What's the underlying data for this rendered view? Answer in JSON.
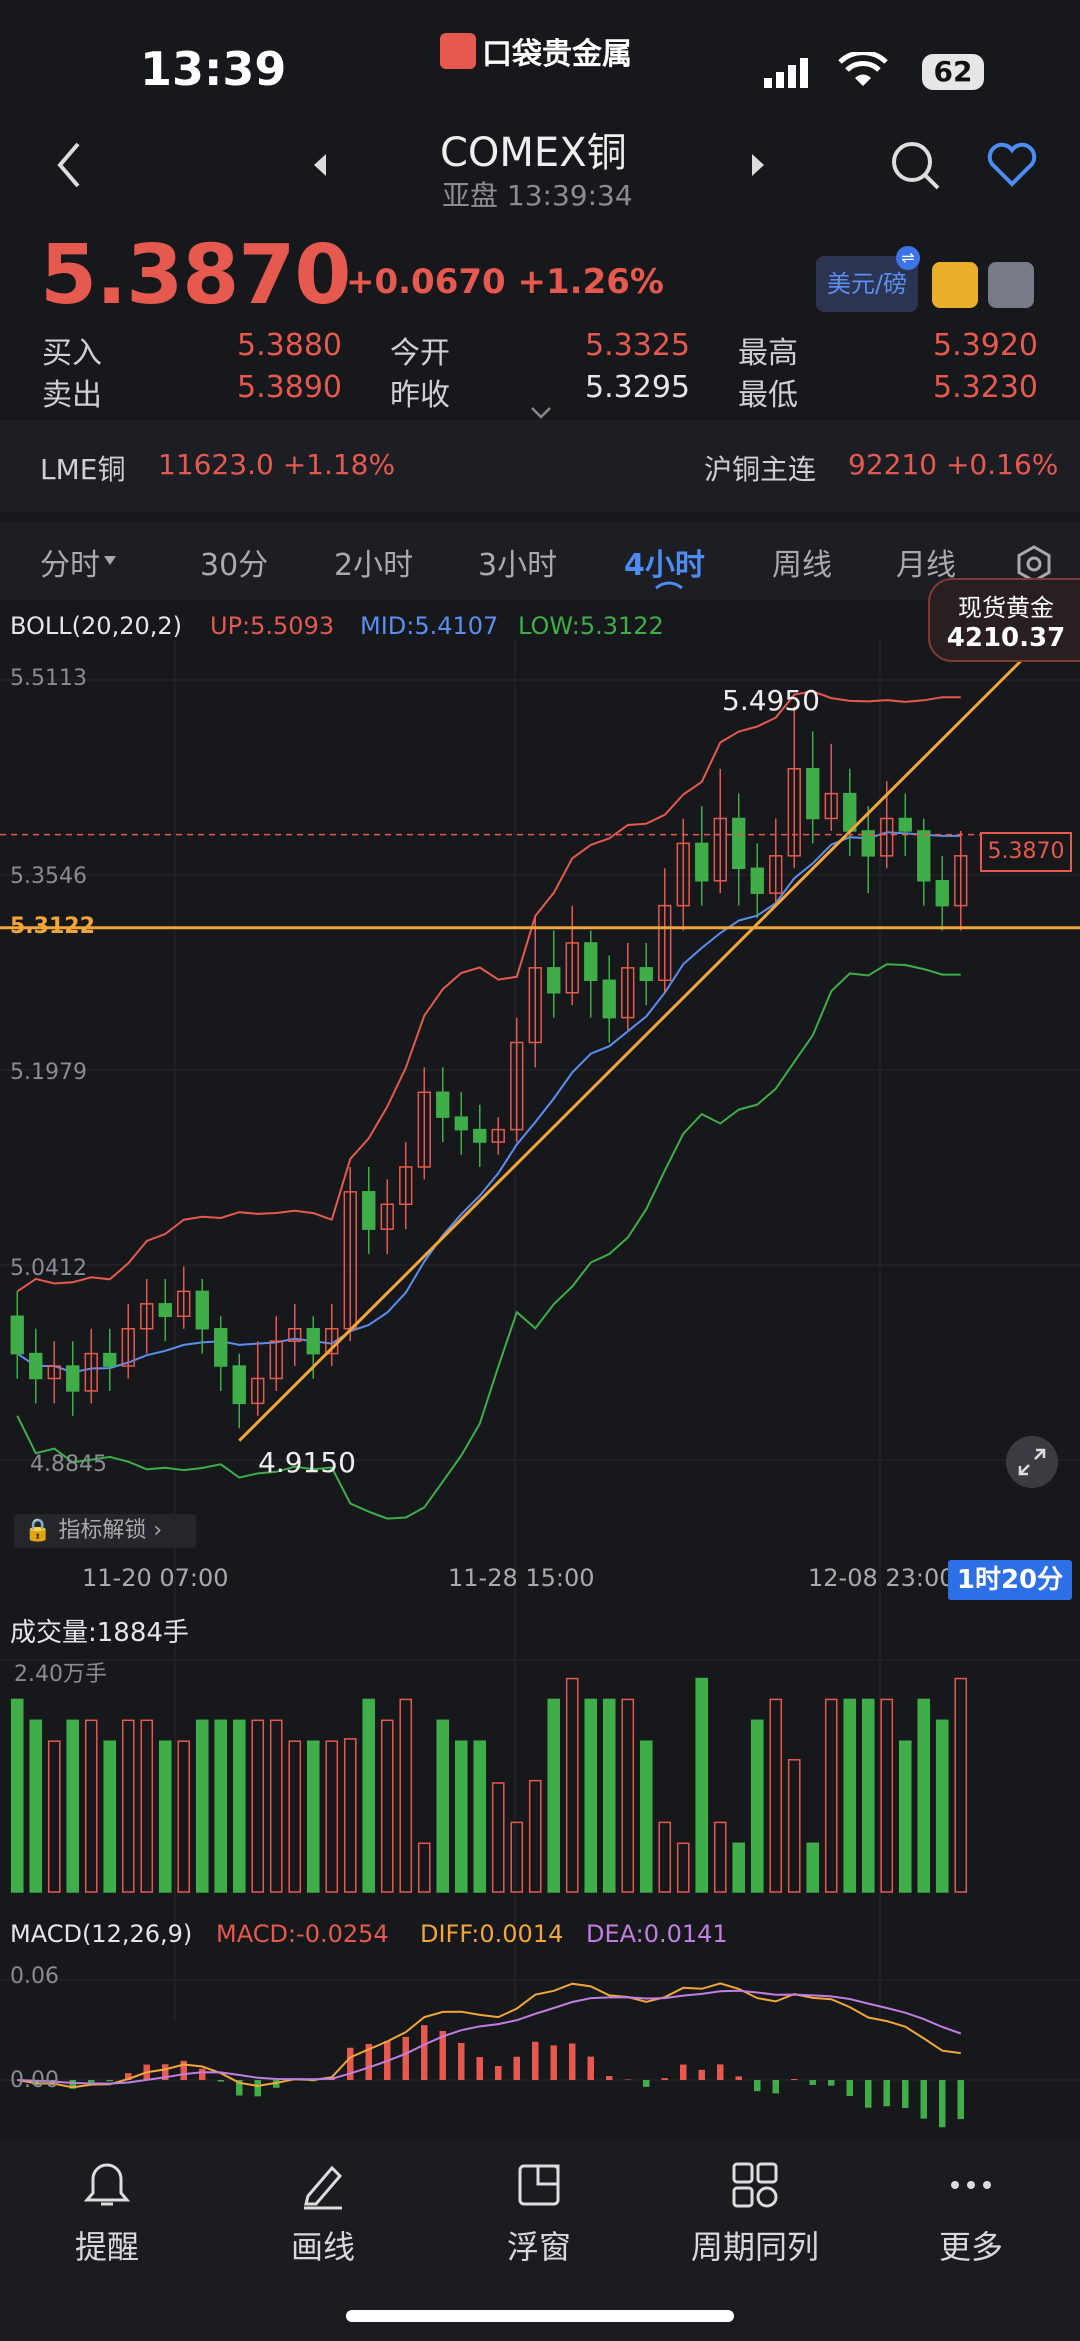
{
  "status_bar": {
    "time": "13:39",
    "battery": "62",
    "logo_text": "口袋贵金属"
  },
  "header": {
    "title": "COMEX铜",
    "subtitle": "亚盘 13:39:34"
  },
  "price": {
    "current": "5.3870",
    "change": "+0.0670 +1.26%",
    "currency_button": "美元/磅",
    "currency_badge": "⇌"
  },
  "quote": {
    "buy_label": "买入",
    "buy_value": "5.3880",
    "sell_label": "卖出",
    "sell_value": "5.3890",
    "open_label": "今开",
    "open_value": "5.3325",
    "prev_close_label": "昨收",
    "prev_close_value": "5.3295",
    "high_label": "最高",
    "high_value": "5.3920",
    "low_label": "最低",
    "low_value": "5.3230"
  },
  "related": {
    "lme_label": "LME铜",
    "lme_value": "11623.0 +1.18%",
    "sh_label": "沪铜主连",
    "sh_value": "92210 +0.16%"
  },
  "tabs": [
    "分时",
    "30分",
    "2小时",
    "3小时",
    "4小时",
    "周线",
    "月线"
  ],
  "active_tab": "4小时",
  "chart_data": {
    "type": "candlestick",
    "indicator": "BOLL(20,20,2)",
    "up_label": "UP:5.5093",
    "mid_label": "MID:5.4107",
    "low_label": "LOW:5.3122",
    "y_ticks": [
      "5.5113",
      "5.3546",
      "5.1979",
      "5.0412",
      "4.8845"
    ],
    "support_level": "5.3122",
    "high_marker": "5.4950",
    "low_marker": "4.9150",
    "current_price_tag": "5.3870",
    "x_ticks": [
      "11-20 07:00",
      "11-28 15:00",
      "12-08 23:00"
    ],
    "countdown": "1时20分",
    "spot_gold_label": "现货黄金",
    "spot_gold_value": "4210.37",
    "unlock_label": "指标解锁",
    "volume_title": "成交量:1884手",
    "volume_max": "2.40万手",
    "macd_title": "MACD(12,26,9)",
    "macd_value": "MACD:-0.0254",
    "diff_value": "DIFF:0.0014",
    "dea_value": "DEA:0.0141",
    "macd_ticks": [
      "0.06",
      "0.00"
    ],
    "candles": [
      [
        5.0,
        4.97,
        5.02,
        4.95
      ],
      [
        4.97,
        4.95,
        4.99,
        4.93
      ],
      [
        4.95,
        4.96,
        4.98,
        4.93
      ],
      [
        4.96,
        4.94,
        4.98,
        4.92
      ],
      [
        4.94,
        4.97,
        4.99,
        4.93
      ],
      [
        4.97,
        4.96,
        4.99,
        4.94
      ],
      [
        4.96,
        4.99,
        5.01,
        4.95
      ],
      [
        4.99,
        5.01,
        5.03,
        4.97
      ],
      [
        5.01,
        5.0,
        5.03,
        4.98
      ],
      [
        5.0,
        5.02,
        5.04,
        4.99
      ],
      [
        5.02,
        4.99,
        5.03,
        4.97
      ],
      [
        4.99,
        4.96,
        5.0,
        4.94
      ],
      [
        4.96,
        4.93,
        4.97,
        4.91
      ],
      [
        4.93,
        4.95,
        4.98,
        4.92
      ],
      [
        4.95,
        4.98,
        5.0,
        4.94
      ],
      [
        4.98,
        4.99,
        5.01,
        4.96
      ],
      [
        4.99,
        4.97,
        5.0,
        4.95
      ],
      [
        4.97,
        4.99,
        5.01,
        4.96
      ],
      [
        4.99,
        5.1,
        5.12,
        4.98
      ],
      [
        5.1,
        5.07,
        5.12,
        5.05
      ],
      [
        5.07,
        5.09,
        5.11,
        5.05
      ],
      [
        5.09,
        5.12,
        5.14,
        5.07
      ],
      [
        5.12,
        5.18,
        5.2,
        5.11
      ],
      [
        5.18,
        5.16,
        5.2,
        5.14
      ],
      [
        5.16,
        5.15,
        5.18,
        5.13
      ],
      [
        5.15,
        5.14,
        5.17,
        5.12
      ],
      [
        5.14,
        5.15,
        5.16,
        5.13
      ],
      [
        5.15,
        5.22,
        5.24,
        5.14
      ],
      [
        5.22,
        5.28,
        5.32,
        5.2
      ],
      [
        5.28,
        5.26,
        5.31,
        5.24
      ],
      [
        5.26,
        5.3,
        5.33,
        5.25
      ],
      [
        5.3,
        5.27,
        5.31,
        5.24
      ],
      [
        5.27,
        5.24,
        5.29,
        5.22
      ],
      [
        5.24,
        5.28,
        5.3,
        5.23
      ],
      [
        5.28,
        5.27,
        5.3,
        5.25
      ],
      [
        5.27,
        5.33,
        5.36,
        5.26
      ],
      [
        5.33,
        5.38,
        5.4,
        5.31
      ],
      [
        5.38,
        5.35,
        5.41,
        5.33
      ],
      [
        5.35,
        5.4,
        5.44,
        5.34
      ],
      [
        5.4,
        5.36,
        5.42,
        5.33
      ],
      [
        5.36,
        5.34,
        5.38,
        5.32
      ],
      [
        5.34,
        5.37,
        5.4,
        5.33
      ],
      [
        5.37,
        5.44,
        5.49,
        5.36
      ],
      [
        5.44,
        5.4,
        5.47,
        5.38
      ],
      [
        5.4,
        5.42,
        5.46,
        5.39
      ],
      [
        5.42,
        5.39,
        5.44,
        5.37
      ],
      [
        5.39,
        5.37,
        5.41,
        5.34
      ],
      [
        5.37,
        5.4,
        5.43,
        5.36
      ],
      [
        5.4,
        5.39,
        5.42,
        5.37
      ],
      [
        5.39,
        5.35,
        5.4,
        5.33
      ],
      [
        5.35,
        5.33,
        5.37,
        5.31
      ],
      [
        5.33,
        5.37,
        5.39,
        5.31
      ]
    ]
  },
  "nav": [
    "提醒",
    "画线",
    "浮窗",
    "周期同列",
    "更多"
  ],
  "colors": {
    "up": "#e5594f",
    "down": "#3fae49",
    "mid": "#5b8ef0",
    "trend": "#f0a63a",
    "dea": "#c07fe0"
  }
}
